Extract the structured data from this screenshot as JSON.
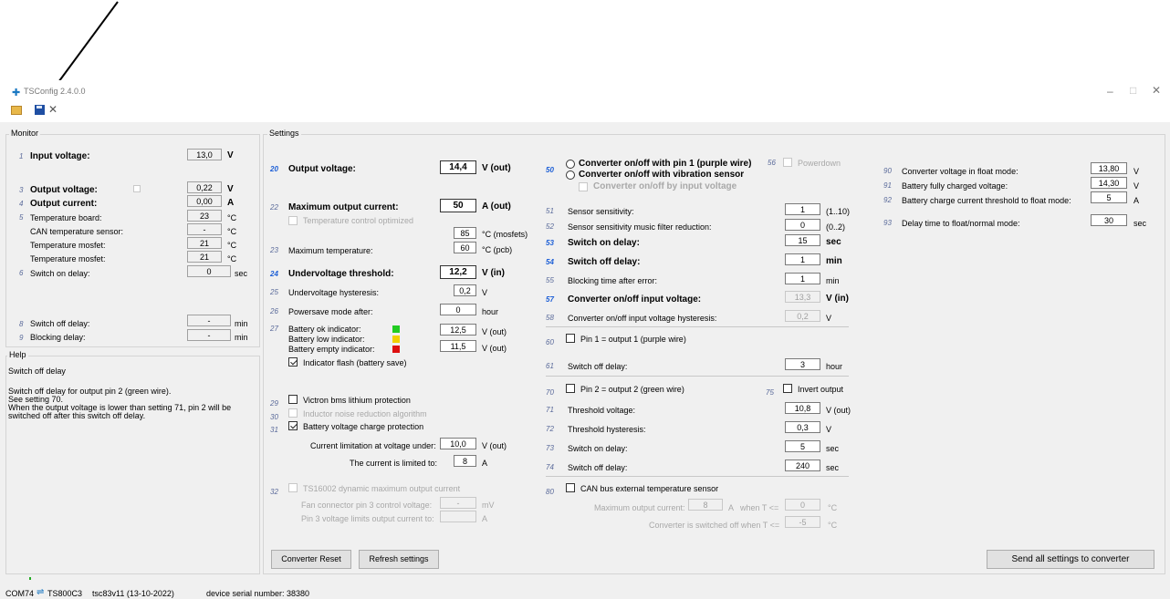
{
  "window": {
    "title": "TSConfig 2.4.0.0",
    "minimize": "–",
    "maximize": "□",
    "close": "✕"
  },
  "toolbar": {
    "open_icon": "folder-open-icon",
    "save_icon": "floppy-disk-icon",
    "tools_icon": "tools-icon"
  },
  "monitor": {
    "group_label": "Monitor",
    "rows": [
      {
        "num": "1",
        "label": "Input voltage:",
        "value": "13,0",
        "unit": "V"
      },
      {
        "num": "3",
        "label": "Output voltage:",
        "value": "0,22",
        "unit": "V"
      },
      {
        "num": "4",
        "label": "Output current:",
        "value": "0,00",
        "unit": "A"
      },
      {
        "num": "5",
        "label": "Temperature board:",
        "value": "23",
        "unit": "°C"
      },
      {
        "num": "",
        "label": "CAN temperature sensor:",
        "value": "-",
        "unit": "°C"
      },
      {
        "num": "",
        "label": "Temperature mosfet:",
        "value": "21",
        "unit": "°C"
      },
      {
        "num": "",
        "label": "Temperature mosfet:",
        "value": "21",
        "unit": "°C"
      },
      {
        "num": "6",
        "label": "Switch on delay:",
        "value": "0",
        "unit": "sec"
      },
      {
        "num": "8",
        "label": "Switch off delay:",
        "value": "-",
        "unit": "min"
      },
      {
        "num": "9",
        "label": "Blocking delay:",
        "value": "-",
        "unit": "min"
      }
    ]
  },
  "help": {
    "group_label": "Help",
    "title": "Switch off delay",
    "line1": "Switch off delay for output pin 2 (green wire).",
    "line2": "See setting 70.",
    "line3": "When the output voltage is lower than setting 71, pin 2 will be",
    "line4": "switched off after this switch off delay."
  },
  "settings": {
    "group_label": "Settings",
    "s20": {
      "num": "20",
      "label": "Output voltage:",
      "value": "14,4",
      "unit": "V (out)"
    },
    "s22": {
      "num": "22",
      "label": "Maximum output current:",
      "value": "50",
      "unit": "A (out)"
    },
    "temp_ctrl": "Temperature control optimized",
    "s23_mosfets": {
      "value": "85",
      "unit": "°C (mosfets)"
    },
    "s23": {
      "num": "23",
      "label": "Maximum temperature:",
      "value": "60",
      "unit": "°C (pcb)"
    },
    "s24": {
      "num": "24",
      "label": "Undervoltage threshold:",
      "value": "12,2",
      "unit": "V (in)"
    },
    "s25": {
      "num": "25",
      "label": "Undervoltage hysteresis:",
      "value": "0,2",
      "unit": "V"
    },
    "s26": {
      "num": "26",
      "label": "Powersave mode after:",
      "value": "0",
      "unit": "hour"
    },
    "s27": {
      "num": "27",
      "ok_label": "Battery ok indicator:",
      "low_label": "Battery low indicator:",
      "empty_label": "Battery empty indicator:",
      "ok_value": "12,5",
      "low_value": "11,5",
      "unit1": "V (out)",
      "unit2": "V (out)",
      "flash_label": "Indicator flash (battery save)",
      "color_ok": "#22cc22",
      "color_low": "#f0d000",
      "color_empty": "#dd1010"
    },
    "s29": {
      "num": "29",
      "label": "Victron bms lithium protection"
    },
    "s30": {
      "num": "30",
      "label": "Inductor noise reduction algorithm"
    },
    "s31": {
      "num": "31",
      "label": "Battery voltage charge protection",
      "cur_lim_label": "Current limitation at voltage under:",
      "cur_lim_value": "10,0",
      "cur_lim_unit": "V (out)",
      "limited_label": "The current is limited to:",
      "limited_value": "8",
      "limited_unit": "A"
    },
    "s32": {
      "num": "32",
      "label": "TS16002 dynamic maximum output current",
      "fan_label": "Fan connector pin 3 control voltage:",
      "fan_value": "-",
      "fan_unit": "mV",
      "pin3_label": "Pin 3 voltage limits output current to:",
      "pin3_value": "",
      "pin3_unit": "A"
    },
    "s50": {
      "num": "50",
      "opt1": "Converter on/off with pin 1 (purple wire)",
      "opt2": "Converter on/off with vibration sensor",
      "opt3": "Converter on/off by input voltage"
    },
    "s56": {
      "num": "56",
      "label": "Powerdown"
    },
    "s51": {
      "num": "51",
      "label": "Sensor sensitivity:",
      "value": "1",
      "unit": "(1..10)"
    },
    "s52": {
      "num": "52",
      "label": "Sensor sensitivity music filter reduction:",
      "value": "0",
      "unit": "(0..2)"
    },
    "s53": {
      "num": "53",
      "label": "Switch on delay:",
      "value": "15",
      "unit": "sec"
    },
    "s54": {
      "num": "54",
      "label": "Switch off delay:",
      "value": "1",
      "unit": "min"
    },
    "s55": {
      "num": "55",
      "label": "Blocking time after error:",
      "value": "1",
      "unit": "min"
    },
    "s57": {
      "num": "57",
      "label": "Converter on/off input voltage:",
      "value": "13,3",
      "unit": "V (in)"
    },
    "s58": {
      "num": "58",
      "label": "Converter on/off input voltage hysteresis:",
      "value": "0,2",
      "unit": "V"
    },
    "s60": {
      "num": "60",
      "label": "Pin 1 = output 1 (purple wire)"
    },
    "s61": {
      "num": "61",
      "label": "Switch off delay:",
      "value": "3",
      "unit": "hour"
    },
    "s70": {
      "num": "70",
      "label": "Pin 2 = output 2 (green wire)"
    },
    "s75": {
      "num": "75",
      "label": "Invert output"
    },
    "s71": {
      "num": "71",
      "label": "Threshold voltage:",
      "value": "10,8",
      "unit": "V (out)"
    },
    "s72": {
      "num": "72",
      "label": "Threshold hysteresis:",
      "value": "0,3",
      "unit": "V"
    },
    "s73": {
      "num": "73",
      "label": "Switch on delay:",
      "value": "5",
      "unit": "sec"
    },
    "s74": {
      "num": "74",
      "label": "Switch off delay:",
      "value": "240",
      "unit": "sec"
    },
    "s80": {
      "num": "80",
      "label": "CAN bus external temperature sensor",
      "max_label": "Maximum output current:",
      "max_value": "8",
      "max_unit": "A",
      "when": "when T <=",
      "when_value": "0",
      "when_unit": "°C",
      "off_label": "Converter is switched off when T <=",
      "off_value": "-5",
      "off_unit": "°C"
    },
    "s90": {
      "num": "90",
      "label": "Converter voltage in float mode:",
      "value": "13,80",
      "unit": "V"
    },
    "s91": {
      "num": "91",
      "label": "Battery fully charged voltage:",
      "value": "14,30",
      "unit": "V"
    },
    "s92": {
      "num": "92",
      "label": "Battery charge current threshold to float mode:",
      "value": "5",
      "unit": "A"
    },
    "s93": {
      "num": "93",
      "label": "Delay time to float/normal mode:",
      "value": "30",
      "unit": "sec"
    },
    "btn_reset": "Converter Reset",
    "btn_refresh": "Refresh settings",
    "btn_send": "Send all settings to converter"
  },
  "status": {
    "port": "COM74",
    "device": "TS800C3",
    "firmware": "tsc83v11 (13-10-2022)",
    "serial": "device serial number: 38380"
  }
}
